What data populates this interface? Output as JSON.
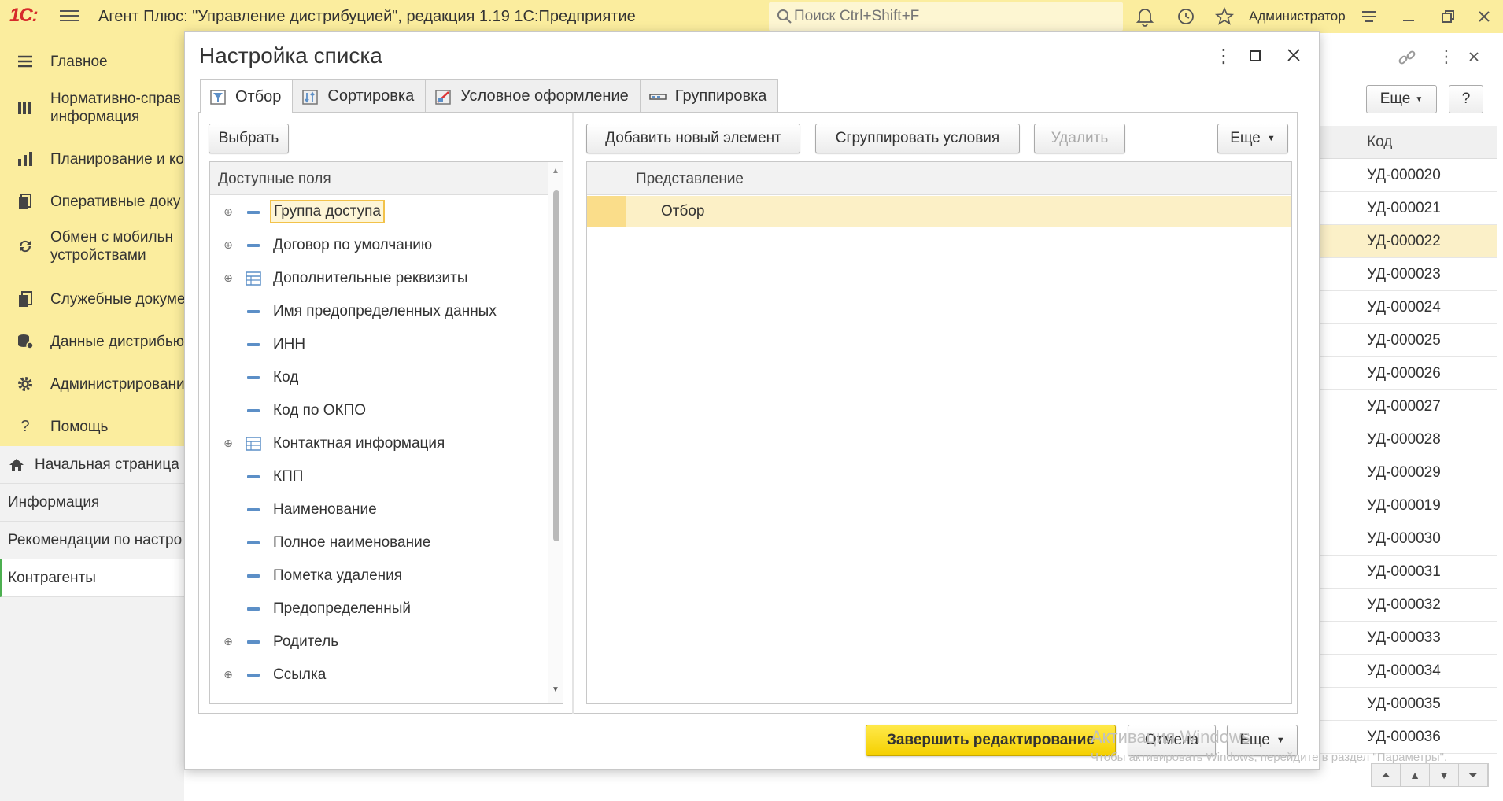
{
  "app": {
    "logo": "1С:",
    "title": "Агент Плюс: \"Управление дистрибуцией\", редакция 1.19 1С:Предприятие",
    "search_placeholder": "Поиск Ctrl+Shift+F",
    "user": "Администратор"
  },
  "sidebar": {
    "items": [
      {
        "label": "Главное",
        "icon": "menu-lines-icon"
      },
      {
        "label": "Нормативно-справочная информация",
        "line1": "Нормативно-справ",
        "line2": "информация",
        "icon": "books-icon"
      },
      {
        "label": "Планирование и ко",
        "icon": "bar-chart-icon"
      },
      {
        "label": "Оперативные доку",
        "icon": "documents-icon"
      },
      {
        "label": "Обмен с мобильными устройствами",
        "line1": "Обмен с мобильн",
        "line2": "устройствами",
        "icon": "sync-icon"
      },
      {
        "label": "Служебные докуме",
        "icon": "service-docs-icon"
      },
      {
        "label": "Данные дистрибью",
        "icon": "database-icon"
      },
      {
        "label": "Администрировани",
        "icon": "gear-icon"
      },
      {
        "label": "Помощь",
        "icon": "question-icon"
      }
    ]
  },
  "subnav": {
    "items": [
      {
        "label": "Начальная страница"
      },
      {
        "label": "Информация"
      },
      {
        "label": "Рекомендации по настро"
      },
      {
        "label": "Контрагенты"
      }
    ]
  },
  "background_list": {
    "more_label": "Еще",
    "help_label": "?",
    "column_header": "Код",
    "codes": [
      "УД-000020",
      "УД-000021",
      "УД-000022",
      "УД-000023",
      "УД-000024",
      "УД-000025",
      "УД-000026",
      "УД-000027",
      "УД-000028",
      "УД-000029",
      "УД-000019",
      "УД-000030",
      "УД-000031",
      "УД-000032",
      "УД-000033",
      "УД-000034",
      "УД-000035",
      "УД-000036"
    ],
    "selected_index": 2
  },
  "dialog": {
    "title": "Настройка списка",
    "tabs": [
      {
        "label": "Отбор",
        "icon": "filter-icon",
        "active": true
      },
      {
        "label": "Сортировка",
        "icon": "sort-icon",
        "active": false
      },
      {
        "label": "Условное оформление",
        "icon": "conditional-format-icon",
        "active": false
      },
      {
        "label": "Группировка",
        "icon": "grouping-icon",
        "active": false
      }
    ],
    "select_button": "Выбрать",
    "add_button": "Добавить новый элемент",
    "group_button": "Сгруппировать условия",
    "delete_button": "Удалить",
    "more_button": "Еще",
    "available_fields_header": "Доступные поля",
    "fields": [
      {
        "label": "Группа доступа",
        "expandable": true,
        "icon": "field-icon",
        "selected": true
      },
      {
        "label": "Договор по умолчанию",
        "expandable": true,
        "icon": "field-icon"
      },
      {
        "label": "Дополнительные реквизиты",
        "expandable": true,
        "icon": "table-icon"
      },
      {
        "label": "Имя предопределенных данных",
        "expandable": false,
        "icon": "field-icon"
      },
      {
        "label": "ИНН",
        "expandable": false,
        "icon": "field-icon"
      },
      {
        "label": "Код",
        "expandable": false,
        "icon": "field-icon"
      },
      {
        "label": "Код по ОКПО",
        "expandable": false,
        "icon": "field-icon"
      },
      {
        "label": "Контактная информация",
        "expandable": true,
        "icon": "table-icon"
      },
      {
        "label": "КПП",
        "expandable": false,
        "icon": "field-icon"
      },
      {
        "label": "Наименование",
        "expandable": false,
        "icon": "field-icon"
      },
      {
        "label": "Полное наименование",
        "expandable": false,
        "icon": "field-icon"
      },
      {
        "label": "Пометка удаления",
        "expandable": false,
        "icon": "field-icon"
      },
      {
        "label": "Предопределенный",
        "expandable": false,
        "icon": "field-icon"
      },
      {
        "label": "Родитель",
        "expandable": true,
        "icon": "field-icon"
      },
      {
        "label": "Ссылка",
        "expandable": true,
        "icon": "field-icon"
      }
    ],
    "presentation_header": "Представление",
    "filter_row": "Отбор",
    "finish_button": "Завершить редактирование",
    "cancel_button": "Отмена",
    "footer_more": "Еще"
  },
  "watermark": {
    "line1": "Активация Windows",
    "line2": "Чтобы активировать Windows, перейдите в раздел \"Параметры\"."
  },
  "colors": {
    "topbar": "#fbed9e",
    "accent_yellow": "#f5d000",
    "selection": "#fcf0c6"
  }
}
